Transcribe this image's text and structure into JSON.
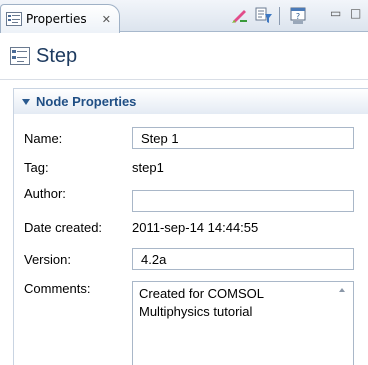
{
  "view": {
    "tab_label": "Properties",
    "icons": [
      "properties-icon",
      "pencil-icon",
      "filter-icon",
      "help-icon"
    ]
  },
  "node": {
    "title": "Step"
  },
  "section": {
    "title": "Node Properties"
  },
  "fields": {
    "name_label": "Name:",
    "name_value": "Step 1",
    "tag_label": "Tag:",
    "tag_value": "step1",
    "author_label": "Author:",
    "author_value": "",
    "date_label": "Date created:",
    "date_value": "2011-sep-14 14:44:55",
    "version_label": "Version:",
    "version_value": "4.2a",
    "comments_label": "Comments:",
    "comments_value": "Created for COMSOL Multiphysics tutorial"
  },
  "colors": {
    "accent": "#1f4e84",
    "title": "#1d3a5f"
  }
}
